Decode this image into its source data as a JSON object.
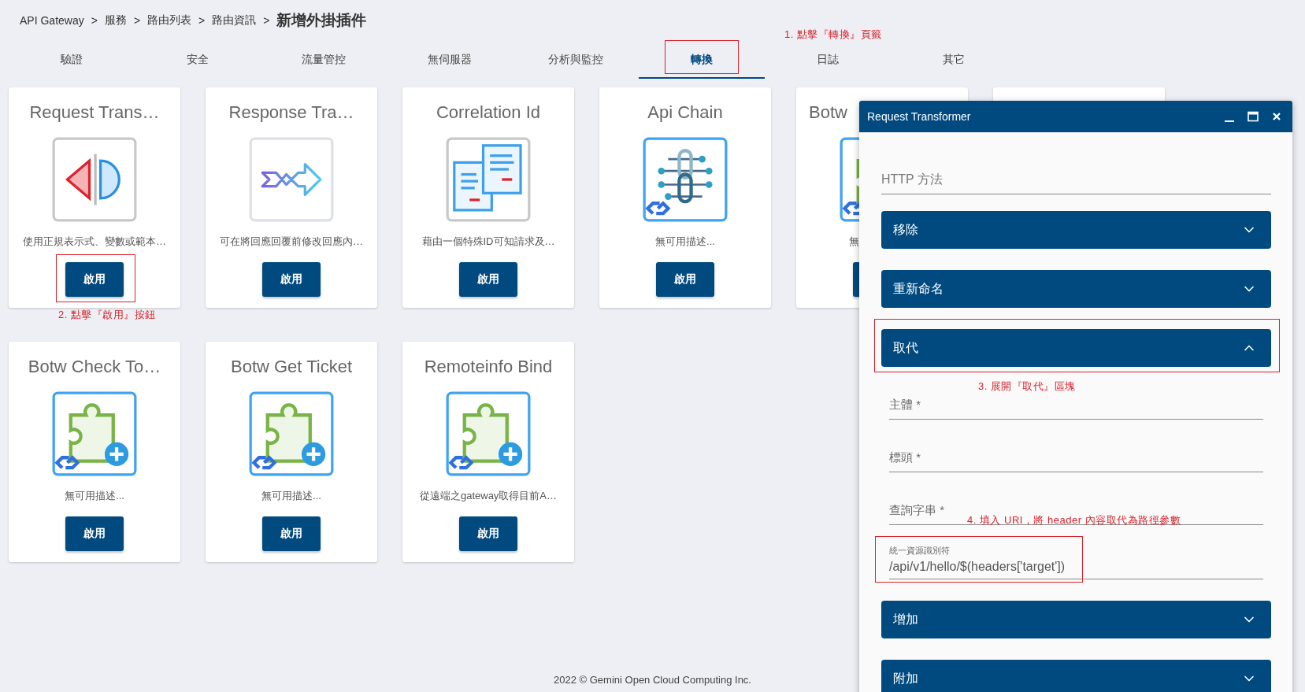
{
  "breadcrumb": [
    {
      "kind": "link",
      "text": "API Gateway"
    },
    {
      "kind": "separator",
      "text": ">"
    },
    {
      "kind": "link",
      "text": "服務"
    },
    {
      "kind": "separator",
      "text": ">"
    },
    {
      "kind": "link",
      "text": "路由列表"
    },
    {
      "kind": "separator",
      "text": ">"
    },
    {
      "kind": "link",
      "text": "路由資訊"
    },
    {
      "kind": "separator",
      "text": ">"
    },
    {
      "kind": "current",
      "text": "新增外掛插件"
    }
  ],
  "tabs": [
    {
      "label": "驗證",
      "selected": false,
      "highlighted": false
    },
    {
      "label": "安全",
      "selected": false,
      "highlighted": false
    },
    {
      "label": "流量管控",
      "selected": false,
      "highlighted": false
    },
    {
      "label": "無伺服器",
      "selected": false,
      "highlighted": false
    },
    {
      "label": "分析與監控",
      "selected": false,
      "highlighted": false
    },
    {
      "label": "轉換",
      "selected": true,
      "highlighted": true,
      "note": "1. 點擊『轉換』頁籤"
    },
    {
      "label": "日誌",
      "selected": false,
      "highlighted": false
    },
    {
      "label": "其它",
      "selected": false,
      "highlighted": false
    }
  ],
  "cards": [
    {
      "kind": "split",
      "title": "Request Trans…",
      "description": "使用正規表示式、變數或範本…",
      "button": "啟用",
      "covered": false,
      "highlighted": true,
      "note": "2. 點擊『啟用』按鈕"
    },
    {
      "kind": "arrow",
      "title": "Response Tra…",
      "description": "可在將回應回覆前修改回應內…",
      "button": "啟用",
      "covered": false,
      "highlighted": false
    },
    {
      "kind": "documents",
      "title": "Correlation Id",
      "description": "藉由一個特殊ID可知請求及…",
      "button": "啟用",
      "covered": false,
      "highlighted": false
    },
    {
      "kind": "chain",
      "title": "Api Chain",
      "description": "無可用描述...",
      "button": "啟用",
      "covered": false,
      "highlighted": false
    },
    {
      "kind": "puzzle",
      "title": "Botw",
      "description": "無",
      "covered": true,
      "highlighted": false
    },
    {
      "kind": "blank"
    },
    {
      "kind": "puzzle",
      "title": "Botw Check To…",
      "description": "無可用描述...",
      "button": "啟用",
      "covered": false,
      "highlighted": false
    },
    {
      "kind": "puzzle",
      "title": "Botw Get Ticket",
      "description": "無可用描述...",
      "button": "啟用",
      "covered": false,
      "highlighted": false
    },
    {
      "kind": "puzzle",
      "title": "Remoteinfo Bind",
      "description": "從遠端之gateway取得目前A…",
      "button": "啟用",
      "covered": false,
      "highlighted": false
    }
  ],
  "footer": "2022 © Gemini Open Cloud Computing Inc.",
  "panel": {
    "title": "Request Transformer",
    "method_field": {
      "placeholder": "HTTP 方法"
    },
    "sections": [
      {
        "title": "移除",
        "expanded": false,
        "highlighted": false
      },
      {
        "title": "重新命名",
        "expanded": false,
        "highlighted": false
      },
      {
        "title": "取代",
        "expanded": true,
        "highlighted": true,
        "note": "3. 展開『取代』區塊",
        "fields": [
          {
            "label": "主體 *",
            "highlighted": false
          },
          {
            "label": "標頭 *",
            "highlighted": false
          },
          {
            "label": "查詢字串 *",
            "highlighted": false
          },
          {
            "label": "統一資源識別符",
            "value": "/api/v1/hello/$(headers['target'])",
            "highlighted": true,
            "note": "4. 填入 URI，將 header 內容取代為路徑參數"
          }
        ]
      },
      {
        "title": "增加",
        "expanded": false,
        "highlighted": false
      },
      {
        "title": "附加",
        "expanded": false,
        "highlighted": false
      }
    ]
  }
}
